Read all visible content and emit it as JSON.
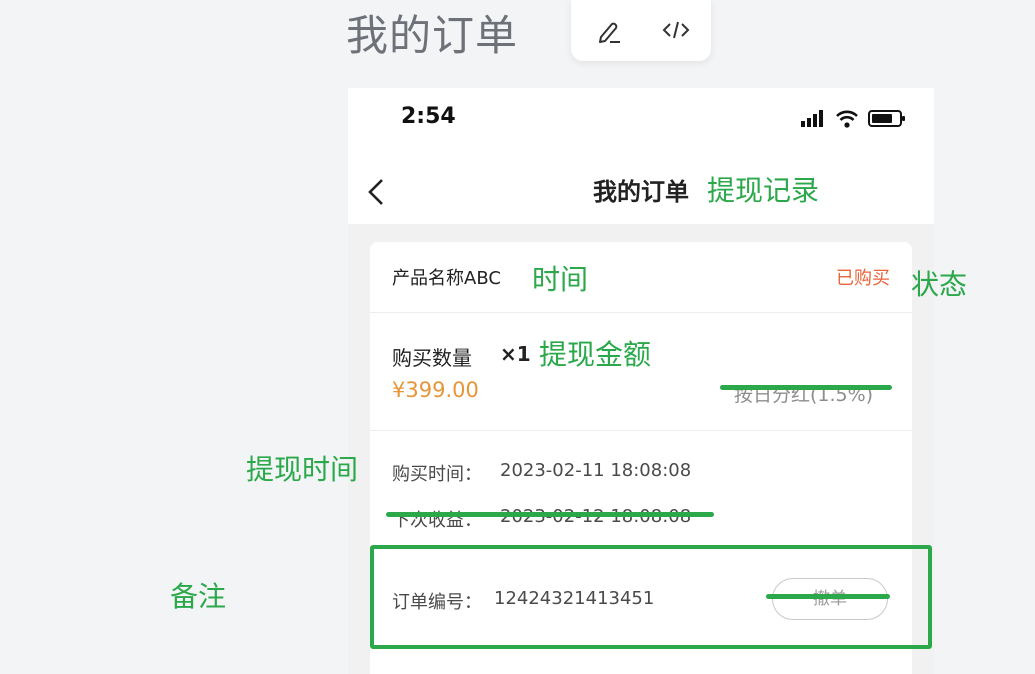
{
  "page_heading": "我的订单",
  "toolbar": {
    "edit_icon": "pencil-icon",
    "code_icon": "code-icon"
  },
  "status_bar": {
    "time": "2:54",
    "icons": [
      "signal-icon",
      "wifi-icon",
      "battery-icon"
    ]
  },
  "nav": {
    "back_icon": "chevron-left-icon",
    "title": "我的订单"
  },
  "order": {
    "product_name": "产品名称ABC",
    "status": "已购买",
    "quantity_label": "购买数量",
    "quantity_value": "×1",
    "price": "¥399.00",
    "dividend_text": "按日分红(1.5%)",
    "purchase_time_label": "购买时间：",
    "purchase_time_value": "2023-02-11 18:08:08",
    "next_income_label": "下次收益：",
    "next_income_value": "2023-02-12 18:08:08",
    "order_no_label": "订单编号：",
    "order_no_value": "12424321413451",
    "cancel_button": "撤单"
  },
  "annotations": {
    "nav_note": "提现记录",
    "name_note": "时间",
    "status_note": "状态",
    "quantity_note": "提现金额",
    "time_note": "提现时间",
    "order_note": "备注"
  },
  "colors": {
    "annotation": "#2aa84a",
    "status": "#e8643a",
    "price": "#e8953a"
  }
}
